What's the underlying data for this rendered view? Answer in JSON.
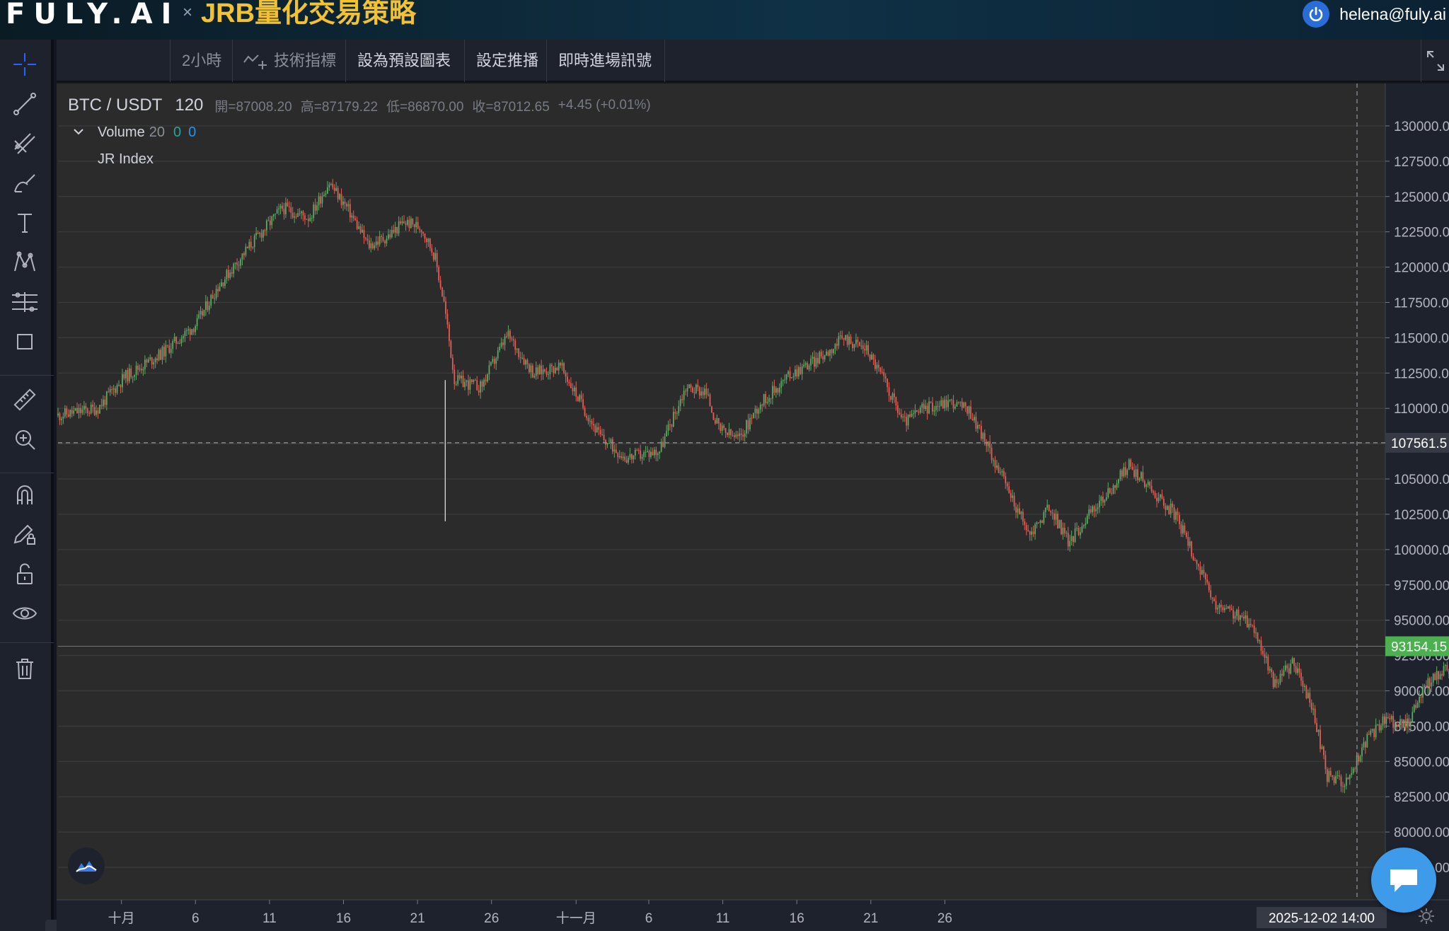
{
  "header": {
    "brand": "FULY.AI",
    "times": "×",
    "title": "JRB量化交易策略",
    "user_email": "helena@fuly.ai"
  },
  "toolbar": {
    "interval_label": "2小時",
    "indicators_label": "技術指標",
    "set_default_label": "設為預設圖表",
    "push_settings_label": "設定推播",
    "signal_label": "即時進場訊號"
  },
  "legend": {
    "symbol": "BTC / USDT",
    "interval": "120",
    "open": "開=87008.20",
    "high": "高=87179.22",
    "low": "低=86870.00",
    "close": "收=87012.65",
    "change": "+4.45 (+0.01%)",
    "volume_name": "Volume",
    "volume_length": "20",
    "volume_value_1": "0",
    "volume_value_2": "0",
    "jr_index_name": "JR Index"
  },
  "colors": {
    "up": "#5ca864",
    "down": "#e25d56",
    "accent": "#2a6dd6",
    "brand_title": "#f2c230",
    "last_price": "#4caf50"
  },
  "icons": [
    "crosshair-icon",
    "trend-line-icon",
    "fib-icon",
    "brush-icon",
    "text-icon",
    "pattern-icon",
    "measure-icon",
    "rectangle-icon",
    "ruler-icon",
    "zoom-icon",
    "magnet-icon",
    "lock-drawing-icon",
    "unlock-icon",
    "eye-icon",
    "trash-icon"
  ],
  "chart_data": {
    "type": "candlestick",
    "symbol": "BTC / USDT",
    "y_axis": {
      "ticks": [
        "130000.00",
        "127500.00",
        "125000.00",
        "122500.00",
        "120000.00",
        "117500.00",
        "115000.00",
        "112500.00",
        "110000.00",
        "107500.00",
        "105000.00",
        "102500.00",
        "100000.00",
        "97500.00",
        "95000.00",
        "92500.00",
        "90000.00",
        "87500.00",
        "85000.00",
        "82500.00",
        "80000.00",
        "77500.00"
      ],
      "ylim": [
        77000,
        131200
      ]
    },
    "x_axis": {
      "ticks": [
        "十月",
        "6",
        "11",
        "16",
        "21",
        "26",
        "十一月",
        "6",
        "11",
        "16",
        "21",
        "26"
      ]
    },
    "crosshair": {
      "price_label": "107561.5",
      "price": 107561.5,
      "time_label": "2025-12-02  14:00"
    },
    "last_price": {
      "label": "93154.15",
      "price": 93154.15
    },
    "close_path": [
      [
        0.0,
        109500
      ],
      [
        0.03,
        110000
      ],
      [
        0.05,
        112200
      ],
      [
        0.08,
        114000
      ],
      [
        0.105,
        116000
      ],
      [
        0.12,
        118500
      ],
      [
        0.145,
        121500
      ],
      [
        0.17,
        124200
      ],
      [
        0.19,
        123500
      ],
      [
        0.205,
        126000
      ],
      [
        0.22,
        124000
      ],
      [
        0.235,
        121500
      ],
      [
        0.25,
        122200
      ],
      [
        0.262,
        123200
      ],
      [
        0.275,
        122800
      ],
      [
        0.285,
        120800
      ],
      [
        0.292,
        117500
      ],
      [
        0.3,
        112000
      ],
      [
        0.32,
        111500
      ],
      [
        0.34,
        115200
      ],
      [
        0.36,
        112500
      ],
      [
        0.38,
        113000
      ],
      [
        0.41,
        108000
      ],
      [
        0.43,
        106500
      ],
      [
        0.455,
        107000
      ],
      [
        0.475,
        111500
      ],
      [
        0.49,
        111200
      ],
      [
        0.5,
        108500
      ],
      [
        0.515,
        107800
      ],
      [
        0.53,
        110200
      ],
      [
        0.555,
        112500
      ],
      [
        0.575,
        113500
      ],
      [
        0.595,
        115000
      ],
      [
        0.612,
        114200
      ],
      [
        0.625,
        112000
      ],
      [
        0.64,
        109000
      ],
      [
        0.655,
        110000
      ],
      [
        0.675,
        110500
      ],
      [
        0.69,
        109800
      ],
      [
        0.705,
        107000
      ],
      [
        0.72,
        104000
      ],
      [
        0.735,
        101000
      ],
      [
        0.75,
        103000
      ],
      [
        0.765,
        100500
      ],
      [
        0.78,
        102500
      ],
      [
        0.795,
        104000
      ],
      [
        0.81,
        106000
      ],
      [
        0.83,
        104000
      ],
      [
        0.845,
        102500
      ],
      [
        0.86,
        99500
      ],
      [
        0.875,
        96000
      ],
      [
        0.89,
        95500
      ],
      [
        0.905,
        94500
      ],
      [
        0.92,
        90500
      ],
      [
        0.935,
        92000
      ],
      [
        0.95,
        88500
      ],
      [
        0.96,
        84000
      ],
      [
        0.975,
        83500
      ],
      [
        0.99,
        86500
      ],
      [
        1.005,
        88000
      ],
      [
        1.02,
        87500
      ],
      [
        1.035,
        90500
      ],
      [
        1.05,
        91500
      ],
      [
        1.065,
        90000
      ],
      [
        1.08,
        88000
      ],
      [
        1.095,
        85500
      ],
      [
        1.1,
        84500
      ],
      [
        1.11,
        86000
      ],
      [
        1.125,
        89500
      ],
      [
        1.13,
        93154
      ]
    ]
  }
}
